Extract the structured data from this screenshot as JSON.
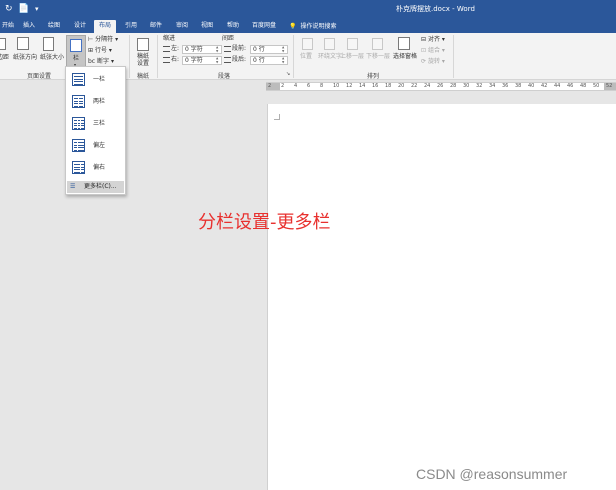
{
  "titlebar": {
    "doc_title": "朴克牌摆放.docx - Word",
    "quick_access": [
      "↻",
      "📄",
      "▾"
    ]
  },
  "tabs": [
    {
      "label": "开始"
    },
    {
      "label": "插入"
    },
    {
      "label": "绘图"
    },
    {
      "label": "设计"
    },
    {
      "label": "布局",
      "active": true
    },
    {
      "label": "引用"
    },
    {
      "label": "邮件"
    },
    {
      "label": "审阅"
    },
    {
      "label": "视图"
    },
    {
      "label": "帮助"
    },
    {
      "label": "百度网盘"
    }
  ],
  "tell_me": "操作说明搜索",
  "ribbon": {
    "page_setup": {
      "group_label": "页面设置",
      "margins_label": "边距",
      "orientation_label": "纸张方向",
      "size_label": "纸张大小",
      "columns_label": "栏",
      "breaks_label": "分隔符",
      "line_numbers_label": "行号",
      "hyphenation_label": "断字"
    },
    "draft": {
      "group_label": "稿纸",
      "button_label": "稿纸\n设置"
    },
    "paragraph": {
      "group_label": "段落",
      "indent_label": "缩进",
      "spacing_label": "间距",
      "left_value": "0 字符",
      "right_value": "0 字符",
      "before_label": "段前:",
      "after_label": "段后:",
      "before_value": "0 行",
      "after_value": "0 行"
    },
    "arrange": {
      "group_label": "排列",
      "position_label": "位置",
      "wrap_label": "环绕文字",
      "forward_label": "上移一层",
      "backward_label": "下移一层",
      "selection_pane_label": "选择窗格",
      "align_label": "对齐",
      "group_btn_label": "组合",
      "rotate_label": "旋转"
    }
  },
  "columns_menu": {
    "items": [
      {
        "label": "一栏",
        "cols": 1
      },
      {
        "label": "两栏",
        "cols": 2
      },
      {
        "label": "三栏",
        "cols": 3
      },
      {
        "label": "偏左",
        "cols": 2
      },
      {
        "label": "偏右",
        "cols": 2
      }
    ],
    "more_label": "更多栏(C)..."
  },
  "ruler": {
    "numbers": [
      "2",
      "2",
      "4",
      "6",
      "8",
      "10",
      "12",
      "14",
      "16",
      "18",
      "20",
      "22",
      "24",
      "26",
      "28",
      "30",
      "32",
      "34",
      "36",
      "38",
      "40",
      "42",
      "44",
      "46",
      "48",
      "50",
      "52"
    ]
  },
  "caption": "分栏设置-更多栏",
  "watermark": "CSDN @reasonsummer",
  "colors": {
    "word_blue": "#2b579a",
    "caption_red": "#e8312f"
  }
}
